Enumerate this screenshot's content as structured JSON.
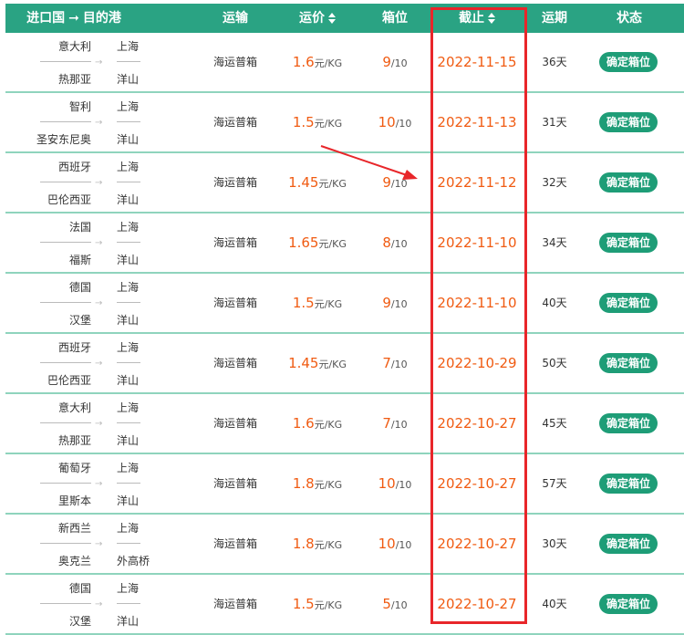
{
  "header": {
    "origin": "进口国",
    "arrow": "➞",
    "destination": "目的港",
    "transport": "运输",
    "price": "运价",
    "box": "箱位",
    "cutoff": "截止",
    "transit": "运期",
    "status": "状态"
  },
  "colors": {
    "header_bg": "#2aa383",
    "accent": "#f05b12",
    "button": "#1e9d77",
    "highlight": "#e8262a",
    "row_divider": "#8fd4bd"
  },
  "rows": [
    {
      "origin_country": "意大利",
      "origin_port": "热那亚",
      "dest_city": "上海",
      "dest_port": "洋山",
      "transport": "海运普箱",
      "price": "1.6",
      "price_unit": "元/KG",
      "box_used": "9",
      "box_total": "/10",
      "cutoff": "2022-11-15",
      "transit": "36天",
      "action": "确定箱位"
    },
    {
      "origin_country": "智利",
      "origin_port": "圣安东尼奥",
      "dest_city": "上海",
      "dest_port": "洋山",
      "transport": "海运普箱",
      "price": "1.5",
      "price_unit": "元/KG",
      "box_used": "10",
      "box_total": "/10",
      "cutoff": "2022-11-13",
      "transit": "31天",
      "action": "确定箱位"
    },
    {
      "origin_country": "西班牙",
      "origin_port": "巴伦西亚",
      "dest_city": "上海",
      "dest_port": "洋山",
      "transport": "海运普箱",
      "price": "1.45",
      "price_unit": "元/KG",
      "box_used": "9",
      "box_total": "/10",
      "cutoff": "2022-11-12",
      "transit": "32天",
      "action": "确定箱位"
    },
    {
      "origin_country": "法国",
      "origin_port": "福斯",
      "dest_city": "上海",
      "dest_port": "洋山",
      "transport": "海运普箱",
      "price": "1.65",
      "price_unit": "元/KG",
      "box_used": "8",
      "box_total": "/10",
      "cutoff": "2022-11-10",
      "transit": "34天",
      "action": "确定箱位"
    },
    {
      "origin_country": "德国",
      "origin_port": "汉堡",
      "dest_city": "上海",
      "dest_port": "洋山",
      "transport": "海运普箱",
      "price": "1.5",
      "price_unit": "元/KG",
      "box_used": "9",
      "box_total": "/10",
      "cutoff": "2022-11-10",
      "transit": "40天",
      "action": "确定箱位"
    },
    {
      "origin_country": "西班牙",
      "origin_port": "巴伦西亚",
      "dest_city": "上海",
      "dest_port": "洋山",
      "transport": "海运普箱",
      "price": "1.45",
      "price_unit": "元/KG",
      "box_used": "7",
      "box_total": "/10",
      "cutoff": "2022-10-29",
      "transit": "50天",
      "action": "确定箱位"
    },
    {
      "origin_country": "意大利",
      "origin_port": "热那亚",
      "dest_city": "上海",
      "dest_port": "洋山",
      "transport": "海运普箱",
      "price": "1.6",
      "price_unit": "元/KG",
      "box_used": "7",
      "box_total": "/10",
      "cutoff": "2022-10-27",
      "transit": "45天",
      "action": "确定箱位"
    },
    {
      "origin_country": "葡萄牙",
      "origin_port": "里斯本",
      "dest_city": "上海",
      "dest_port": "洋山",
      "transport": "海运普箱",
      "price": "1.8",
      "price_unit": "元/KG",
      "box_used": "10",
      "box_total": "/10",
      "cutoff": "2022-10-27",
      "transit": "57天",
      "action": "确定箱位"
    },
    {
      "origin_country": "新西兰",
      "origin_port": "奥克兰",
      "dest_city": "上海",
      "dest_port": "外高桥",
      "transport": "海运普箱",
      "price": "1.8",
      "price_unit": "元/KG",
      "box_used": "10",
      "box_total": "/10",
      "cutoff": "2022-10-27",
      "transit": "30天",
      "action": "确定箱位"
    },
    {
      "origin_country": "德国",
      "origin_port": "汉堡",
      "dest_city": "上海",
      "dest_port": "洋山",
      "transport": "海运普箱",
      "price": "1.5",
      "price_unit": "元/KG",
      "box_used": "5",
      "box_total": "/10",
      "cutoff": "2022-10-27",
      "transit": "40天",
      "action": "确定箱位"
    }
  ]
}
